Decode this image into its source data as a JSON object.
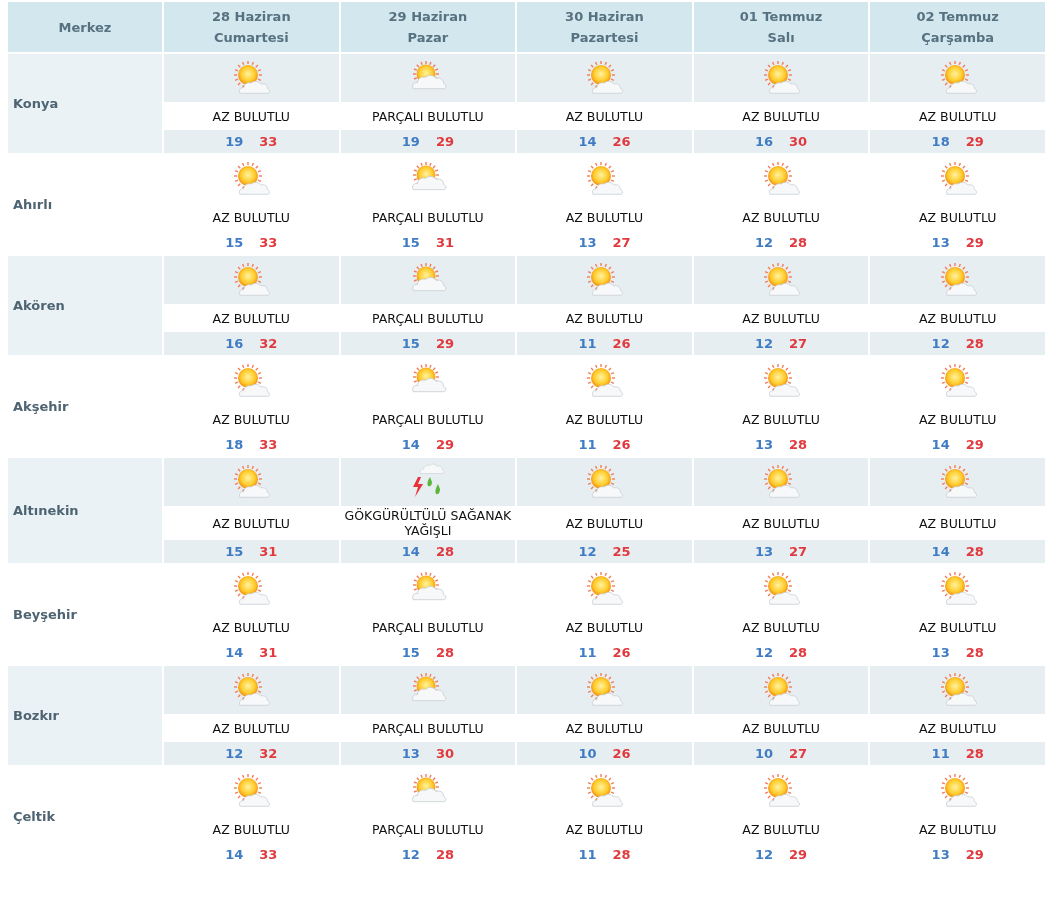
{
  "header": {
    "station_label": "Merkez",
    "days": [
      {
        "date": "28 Haziran",
        "weekday": "Cumartesi"
      },
      {
        "date": "29 Haziran",
        "weekday": "Pazar"
      },
      {
        "date": "30 Haziran",
        "weekday": "Pazartesi"
      },
      {
        "date": "01 Temmuz",
        "weekday": "Salı"
      },
      {
        "date": "02 Temmuz",
        "weekday": "Çarşamba"
      }
    ]
  },
  "stations": [
    {
      "name": "Konya",
      "forecasts": [
        {
          "kind": "few-clouds",
          "condition": "AZ BULUTLU",
          "low": "19",
          "high": "33"
        },
        {
          "kind": "partly-cloudy",
          "condition": "PARÇALI BULUTLU",
          "low": "19",
          "high": "29"
        },
        {
          "kind": "few-clouds",
          "condition": "AZ BULUTLU",
          "low": "14",
          "high": "26"
        },
        {
          "kind": "few-clouds",
          "condition": "AZ BULUTLU",
          "low": "16",
          "high": "30"
        },
        {
          "kind": "few-clouds",
          "condition": "AZ BULUTLU",
          "low": "18",
          "high": "29"
        }
      ]
    },
    {
      "name": "Ahırlı",
      "forecasts": [
        {
          "kind": "few-clouds",
          "condition": "AZ BULUTLU",
          "low": "15",
          "high": "33"
        },
        {
          "kind": "partly-cloudy",
          "condition": "PARÇALI BULUTLU",
          "low": "15",
          "high": "31"
        },
        {
          "kind": "few-clouds",
          "condition": "AZ BULUTLU",
          "low": "13",
          "high": "27"
        },
        {
          "kind": "few-clouds",
          "condition": "AZ BULUTLU",
          "low": "12",
          "high": "28"
        },
        {
          "kind": "few-clouds",
          "condition": "AZ BULUTLU",
          "low": "13",
          "high": "29"
        }
      ]
    },
    {
      "name": "Akören",
      "forecasts": [
        {
          "kind": "few-clouds",
          "condition": "AZ BULUTLU",
          "low": "16",
          "high": "32"
        },
        {
          "kind": "partly-cloudy",
          "condition": "PARÇALI BULUTLU",
          "low": "15",
          "high": "29"
        },
        {
          "kind": "few-clouds",
          "condition": "AZ BULUTLU",
          "low": "11",
          "high": "26"
        },
        {
          "kind": "few-clouds",
          "condition": "AZ BULUTLU",
          "low": "12",
          "high": "27"
        },
        {
          "kind": "few-clouds",
          "condition": "AZ BULUTLU",
          "low": "12",
          "high": "28"
        }
      ]
    },
    {
      "name": "Akşehir",
      "forecasts": [
        {
          "kind": "few-clouds",
          "condition": "AZ BULUTLU",
          "low": "18",
          "high": "33"
        },
        {
          "kind": "partly-cloudy",
          "condition": "PARÇALI BULUTLU",
          "low": "14",
          "high": "29"
        },
        {
          "kind": "few-clouds",
          "condition": "AZ BULUTLU",
          "low": "11",
          "high": "26"
        },
        {
          "kind": "few-clouds",
          "condition": "AZ BULUTLU",
          "low": "13",
          "high": "28"
        },
        {
          "kind": "few-clouds",
          "condition": "AZ BULUTLU",
          "low": "14",
          "high": "29"
        }
      ]
    },
    {
      "name": "Altınekin",
      "forecasts": [
        {
          "kind": "few-clouds",
          "condition": "AZ BULUTLU",
          "low": "15",
          "high": "31"
        },
        {
          "kind": "thunderstorm",
          "condition": "GÖKGÜRÜLTÜLÜ SAĞANAK YAĞIŞLI",
          "low": "14",
          "high": "28"
        },
        {
          "kind": "few-clouds",
          "condition": "AZ BULUTLU",
          "low": "12",
          "high": "25"
        },
        {
          "kind": "few-clouds",
          "condition": "AZ BULUTLU",
          "low": "13",
          "high": "27"
        },
        {
          "kind": "few-clouds",
          "condition": "AZ BULUTLU",
          "low": "14",
          "high": "28"
        }
      ]
    },
    {
      "name": "Beyşehir",
      "forecasts": [
        {
          "kind": "few-clouds",
          "condition": "AZ BULUTLU",
          "low": "14",
          "high": "31"
        },
        {
          "kind": "partly-cloudy",
          "condition": "PARÇALI BULUTLU",
          "low": "15",
          "high": "28"
        },
        {
          "kind": "few-clouds",
          "condition": "AZ BULUTLU",
          "low": "11",
          "high": "26"
        },
        {
          "kind": "few-clouds",
          "condition": "AZ BULUTLU",
          "low": "12",
          "high": "28"
        },
        {
          "kind": "few-clouds",
          "condition": "AZ BULUTLU",
          "low": "13",
          "high": "28"
        }
      ]
    },
    {
      "name": "Bozkır",
      "forecasts": [
        {
          "kind": "few-clouds",
          "condition": "AZ BULUTLU",
          "low": "12",
          "high": "32"
        },
        {
          "kind": "partly-cloudy",
          "condition": "PARÇALI BULUTLU",
          "low": "13",
          "high": "30"
        },
        {
          "kind": "few-clouds",
          "condition": "AZ BULUTLU",
          "low": "10",
          "high": "26"
        },
        {
          "kind": "few-clouds",
          "condition": "AZ BULUTLU",
          "low": "10",
          "high": "27"
        },
        {
          "kind": "few-clouds",
          "condition": "AZ BULUTLU",
          "low": "11",
          "high": "28"
        }
      ]
    },
    {
      "name": "Çeltik",
      "forecasts": [
        {
          "kind": "few-clouds",
          "condition": "AZ BULUTLU",
          "low": "14",
          "high": "33"
        },
        {
          "kind": "partly-cloudy",
          "condition": "PARÇALI BULUTLU",
          "low": "12",
          "high": "28"
        },
        {
          "kind": "few-clouds",
          "condition": "AZ BULUTLU",
          "low": "11",
          "high": "28"
        },
        {
          "kind": "few-clouds",
          "condition": "AZ BULUTLU",
          "low": "12",
          "high": "29"
        },
        {
          "kind": "few-clouds",
          "condition": "AZ BULUTLU",
          "low": "13",
          "high": "29"
        }
      ]
    }
  ]
}
